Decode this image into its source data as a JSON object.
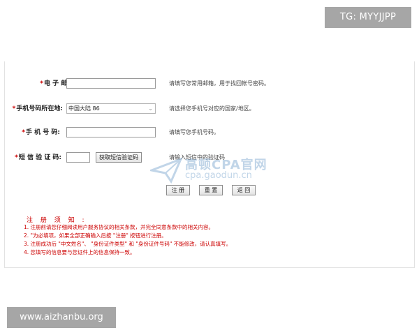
{
  "overlay": {
    "tag_badge": "TG: MYYJJPP",
    "site_badge": "www.aizhanbu.org"
  },
  "form": {
    "email": {
      "required_mark": "*",
      "label": "电 子 邮 箱:",
      "value": "",
      "hint": "请填写您常用邮箱，用于找回帐号密码。"
    },
    "phone_region": {
      "required_mark": "*",
      "label": "手机号码所在地:",
      "selected": "中国大陆 86",
      "hint": "请选择您手机号对应的国家/地区。"
    },
    "phone": {
      "required_mark": "*",
      "label": "手 机 号 码:",
      "value": "",
      "hint": "请填写您手机号码。"
    },
    "sms_code": {
      "required_mark": "*",
      "label": "短 信 验 证 码:",
      "value": "",
      "button": "获取短信验证码",
      "hint": "请输入短信中的验证码"
    },
    "actions": {
      "register": "注 册",
      "reset": "重 置",
      "back": "返 回"
    }
  },
  "watermark": {
    "cn": "高顿CPA官网",
    "en": "cpa.gaodun.cn"
  },
  "notice": {
    "title": "注 册 须 知 :",
    "items": [
      "1. 注册前请您仔细阅读用户服务协议的相关条款，并完全同意条款中的相关内容。",
      "2. \"为必填项，如果全部正确输入后按 \"注册\" 按钮进行注册。",
      "3. 注册成功后 \"中文姓名\"、 \"身份证件类型\" 和 \"身份证件号码\" 不能修改，请认真填写。",
      "4. 您填写的信息要与您证件上的信息保持一致。"
    ]
  },
  "colors": {
    "required": "#cc0000",
    "notice": "#cc0000",
    "watermark": "#8fb4d6",
    "badge_bg": "#a6a6a6"
  }
}
